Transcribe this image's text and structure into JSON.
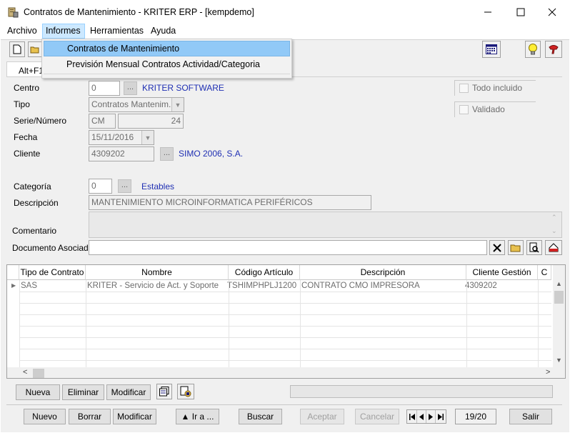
{
  "window": {
    "title": "Contratos de Mantenimiento - KRITER ERP - [kempdemo]"
  },
  "menubar": {
    "items": [
      "Archivo",
      "Informes",
      "Herramientas",
      "Ayuda"
    ]
  },
  "dropdown": {
    "items": [
      "Contratos de Mantenimiento",
      "Previsión Mensual Contratos Actividad/Categoria"
    ]
  },
  "tab": {
    "label": "Alt+F1"
  },
  "form": {
    "centro": {
      "label": "Centro",
      "value": "0",
      "link": "KRITER SOFTWARE"
    },
    "tipo": {
      "label": "Tipo",
      "value": "Contratos Mantenim."
    },
    "serie": {
      "label": "Serie/Número",
      "serie": "CM",
      "numero": "24"
    },
    "fecha": {
      "label": "Fecha",
      "value": "15/11/2016"
    },
    "cliente": {
      "label": "Cliente",
      "value": "4309202",
      "link": "SIMO 2006, S.A."
    },
    "categoria": {
      "label": "Categoría",
      "value": "0",
      "link": "Estables"
    },
    "descripcion": {
      "label": "Descripción",
      "value": "MANTENIMIENTO MICROINFORMATICA PERIFÉRICOS"
    },
    "comentario": {
      "label": "Comentario",
      "value": ""
    },
    "documento": {
      "label": "Documento Asociado",
      "value": ""
    },
    "todo_incluido": {
      "label": "Todo incluido",
      "checked": false
    },
    "validado": {
      "label": "Validado",
      "checked": false
    }
  },
  "grid": {
    "columns": [
      "Tipo de Contrato",
      "Nombre",
      "Código Artículo",
      "Descripción",
      "Cliente Gestión",
      "C"
    ],
    "rows": [
      [
        "SAS",
        "KRITER - Servicio de Act. y Soporte",
        "TSHIMPHPLJ1200",
        "CONTRATO CMO IMPRESORA",
        "4309202"
      ]
    ]
  },
  "line_buttons": {
    "nueva": "Nueva",
    "eliminar": "Eliminar",
    "modificar": "Modificar"
  },
  "bottom_buttons": {
    "nuevo": "Nuevo",
    "borrar": "Borrar",
    "modificar": "Modificar",
    "ir_a": "▲ Ir a ...",
    "buscar": "Buscar",
    "aceptar": "Aceptar",
    "cancelar": "Cancelar",
    "record": "19/20",
    "salir": "Salir"
  },
  "icons": {
    "new_doc": "new-document-icon",
    "open": "open-folder-icon",
    "calendar": "calendar-icon",
    "bulb": "lightbulb-icon",
    "help": "help-icon"
  }
}
